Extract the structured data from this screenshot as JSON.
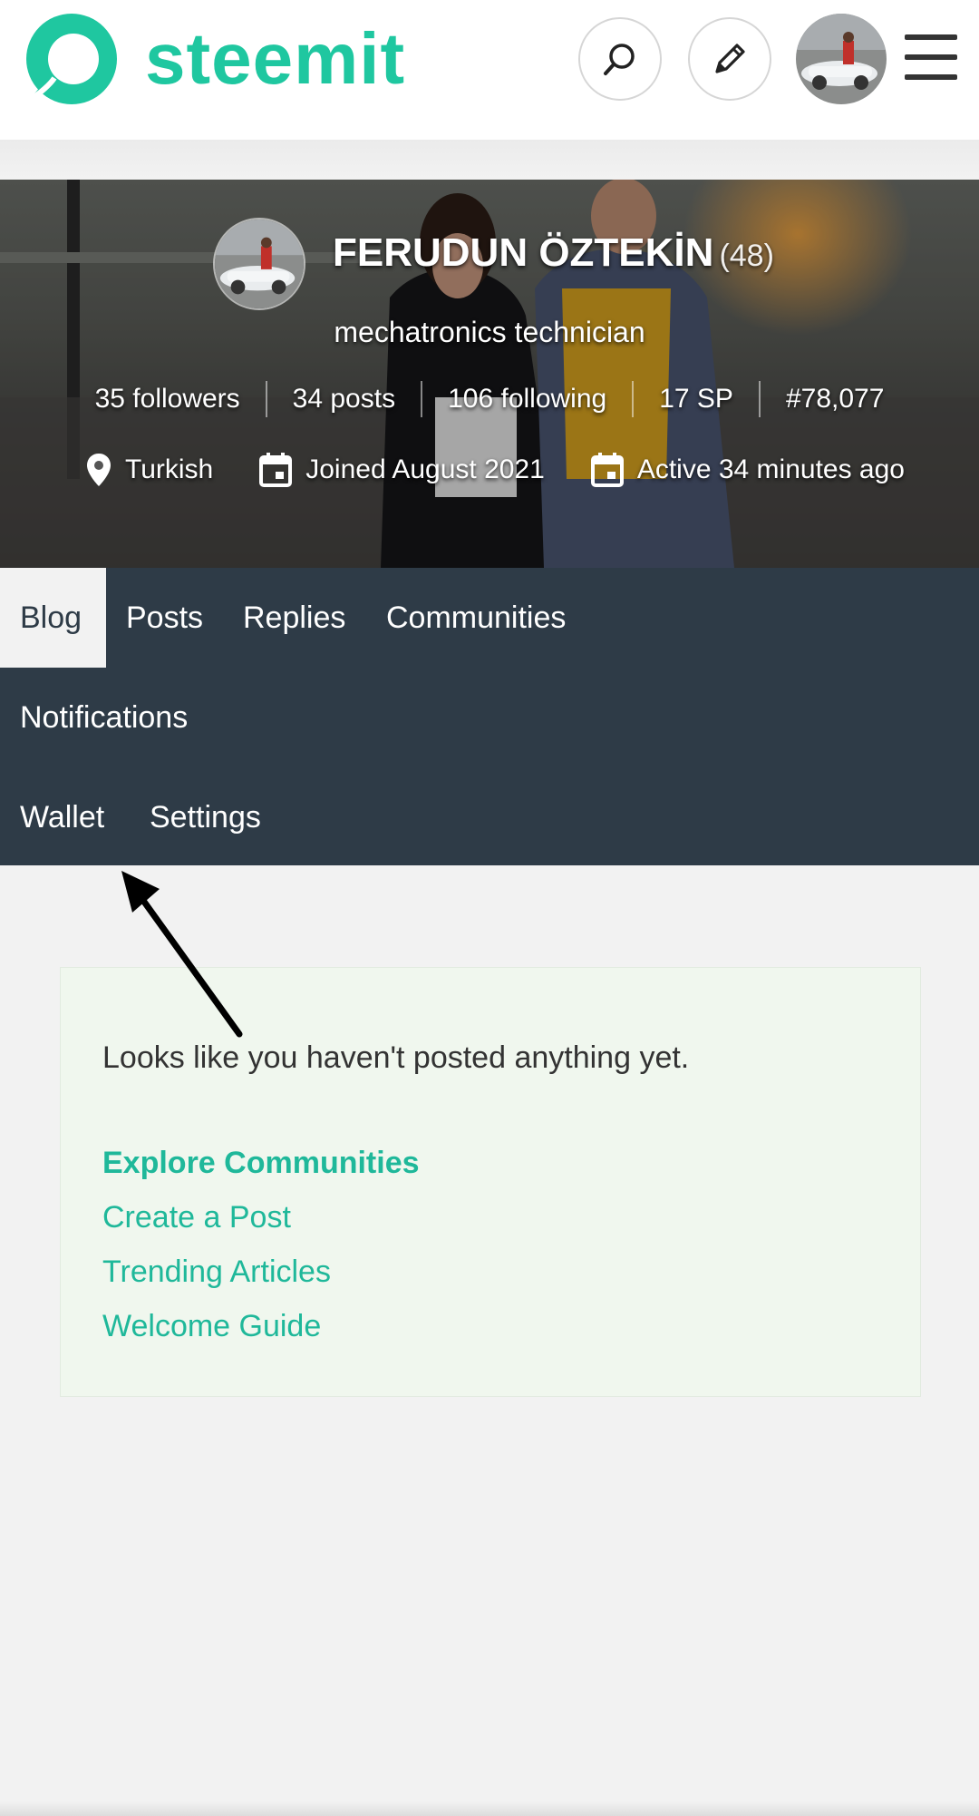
{
  "header": {
    "brand": "steemit",
    "icons": {
      "logo": "steemit-logo-icon",
      "search": "search-icon",
      "write": "pencil-icon",
      "menu": "hamburger-menu-icon"
    },
    "accent_color": "#1fc7a0"
  },
  "profile": {
    "name": "FERUDUN ÖZTEKİN",
    "reputation": "(48)",
    "about": "mechatronics technician",
    "stats": [
      {
        "label": "35 followers"
      },
      {
        "label": "34 posts"
      },
      {
        "label": "106 following"
      },
      {
        "label": "17 SP"
      },
      {
        "label": "#78,077"
      }
    ],
    "location": "Turkish",
    "joined": "Joined August 2021",
    "active": "Active 34 minutes ago"
  },
  "tabs": {
    "blog": "Blog",
    "posts": "Posts",
    "replies": "Replies",
    "communities": "Communities",
    "notifications": "Notifications",
    "wallet": "Wallet",
    "settings": "Settings",
    "active": "Blog",
    "bar_color": "#2e3b47"
  },
  "empty_state": {
    "message": "Looks like you haven't posted anything yet.",
    "links": {
      "explore": "Explore Communities",
      "create": "Create a Post",
      "trending": "Trending Articles",
      "welcome": "Welcome Guide"
    },
    "link_color": "#1fb89a"
  }
}
